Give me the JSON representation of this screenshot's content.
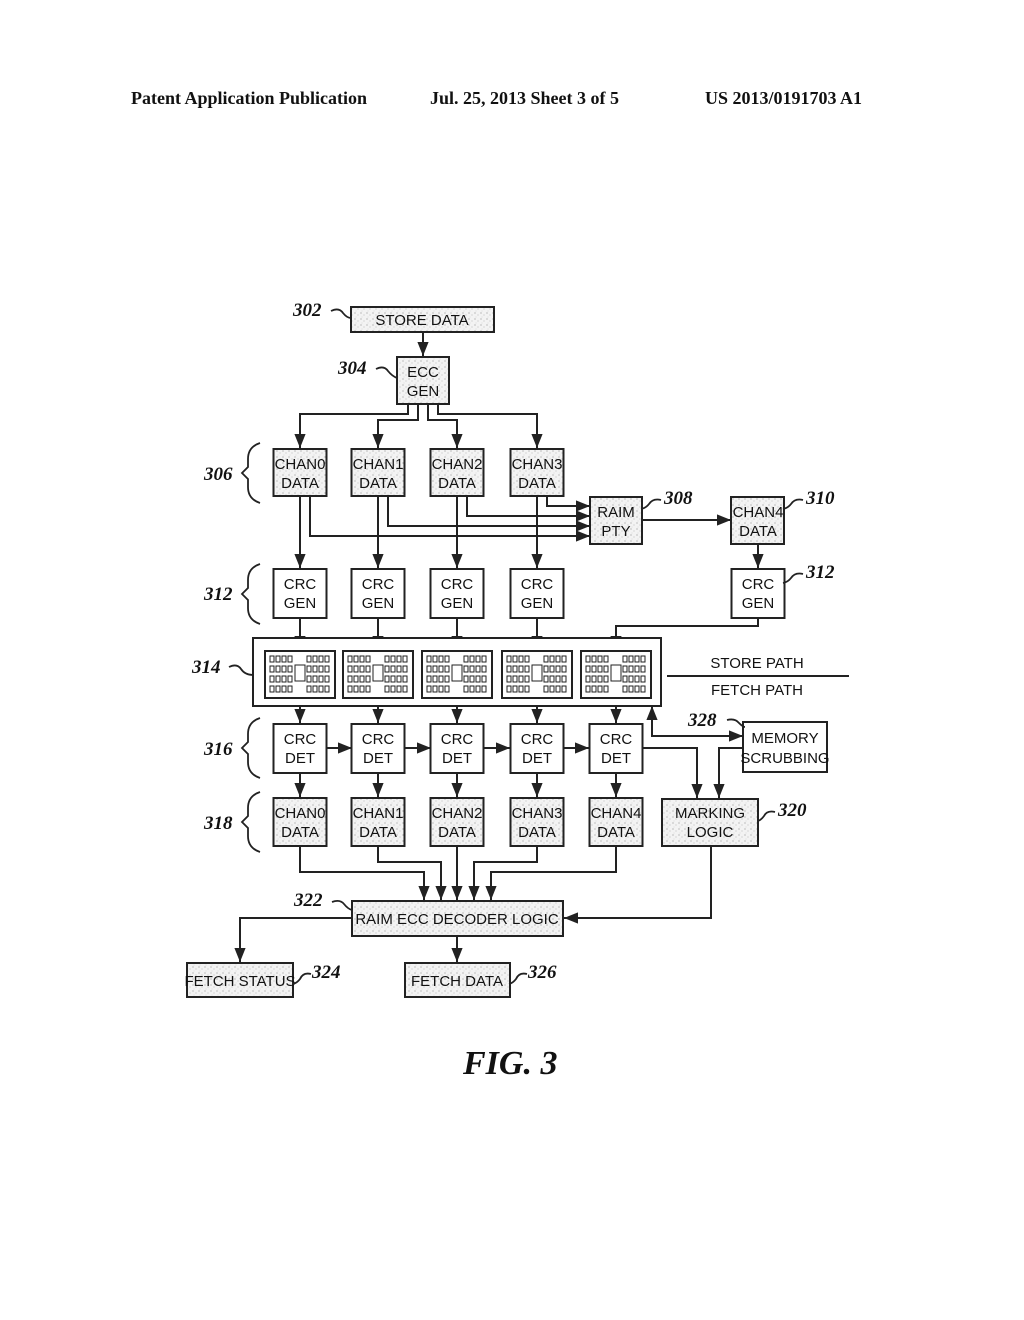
{
  "header": {
    "publication": "Patent Application Publication",
    "date_sheet": "Jul. 25, 2013   Sheet 3 of 5",
    "number": "US 2013/0191703 A1"
  },
  "figure": {
    "caption": "FIG.  3"
  },
  "blocks": {
    "store_data": {
      "ref": "302",
      "line1": "STORE DATA"
    },
    "ecc_gen": {
      "ref": "304",
      "line1": "ECC",
      "line2": "GEN"
    },
    "store_chan_group_ref": "306",
    "store_chans": [
      {
        "line1": "CHAN0",
        "line2": "DATA"
      },
      {
        "line1": "CHAN1",
        "line2": "DATA"
      },
      {
        "line1": "CHAN2",
        "line2": "DATA"
      },
      {
        "line1": "CHAN3",
        "line2": "DATA"
      }
    ],
    "raim_pty": {
      "ref": "308",
      "line1": "RAIM",
      "line2": "PTY"
    },
    "chan4_store": {
      "ref": "310",
      "line1": "CHAN4",
      "line2": "DATA"
    },
    "crc_gen_group_ref": "312",
    "crc_gen_single_ref": "312",
    "crc_gen": {
      "line1": "CRC",
      "line2": "GEN"
    },
    "memory_ref": "314",
    "store_path": "STORE PATH",
    "fetch_path": "FETCH PATH",
    "crc_det_group_ref": "316",
    "crc_det": {
      "line1": "CRC",
      "line2": "DET"
    },
    "fetch_chan_group_ref": "318",
    "fetch_chans": [
      {
        "line1": "CHAN0",
        "line2": "DATA"
      },
      {
        "line1": "CHAN1",
        "line2": "DATA"
      },
      {
        "line1": "CHAN2",
        "line2": "DATA"
      },
      {
        "line1": "CHAN3",
        "line2": "DATA"
      },
      {
        "line1": "CHAN4",
        "line2": "DATA"
      }
    ],
    "memory_scrubbing": {
      "ref": "328",
      "line1": "MEMORY",
      "line2": "SCRUBBING"
    },
    "marking_logic": {
      "ref": "320",
      "line1": "MARKING",
      "line2": "LOGIC"
    },
    "raim_ecc_decoder": {
      "ref": "322",
      "line1": "RAIM ECC DECODER LOGIC"
    },
    "fetch_status": {
      "ref": "324",
      "line1": "FETCH STATUS"
    },
    "fetch_data": {
      "ref": "326",
      "line1": "FETCH DATA"
    }
  }
}
